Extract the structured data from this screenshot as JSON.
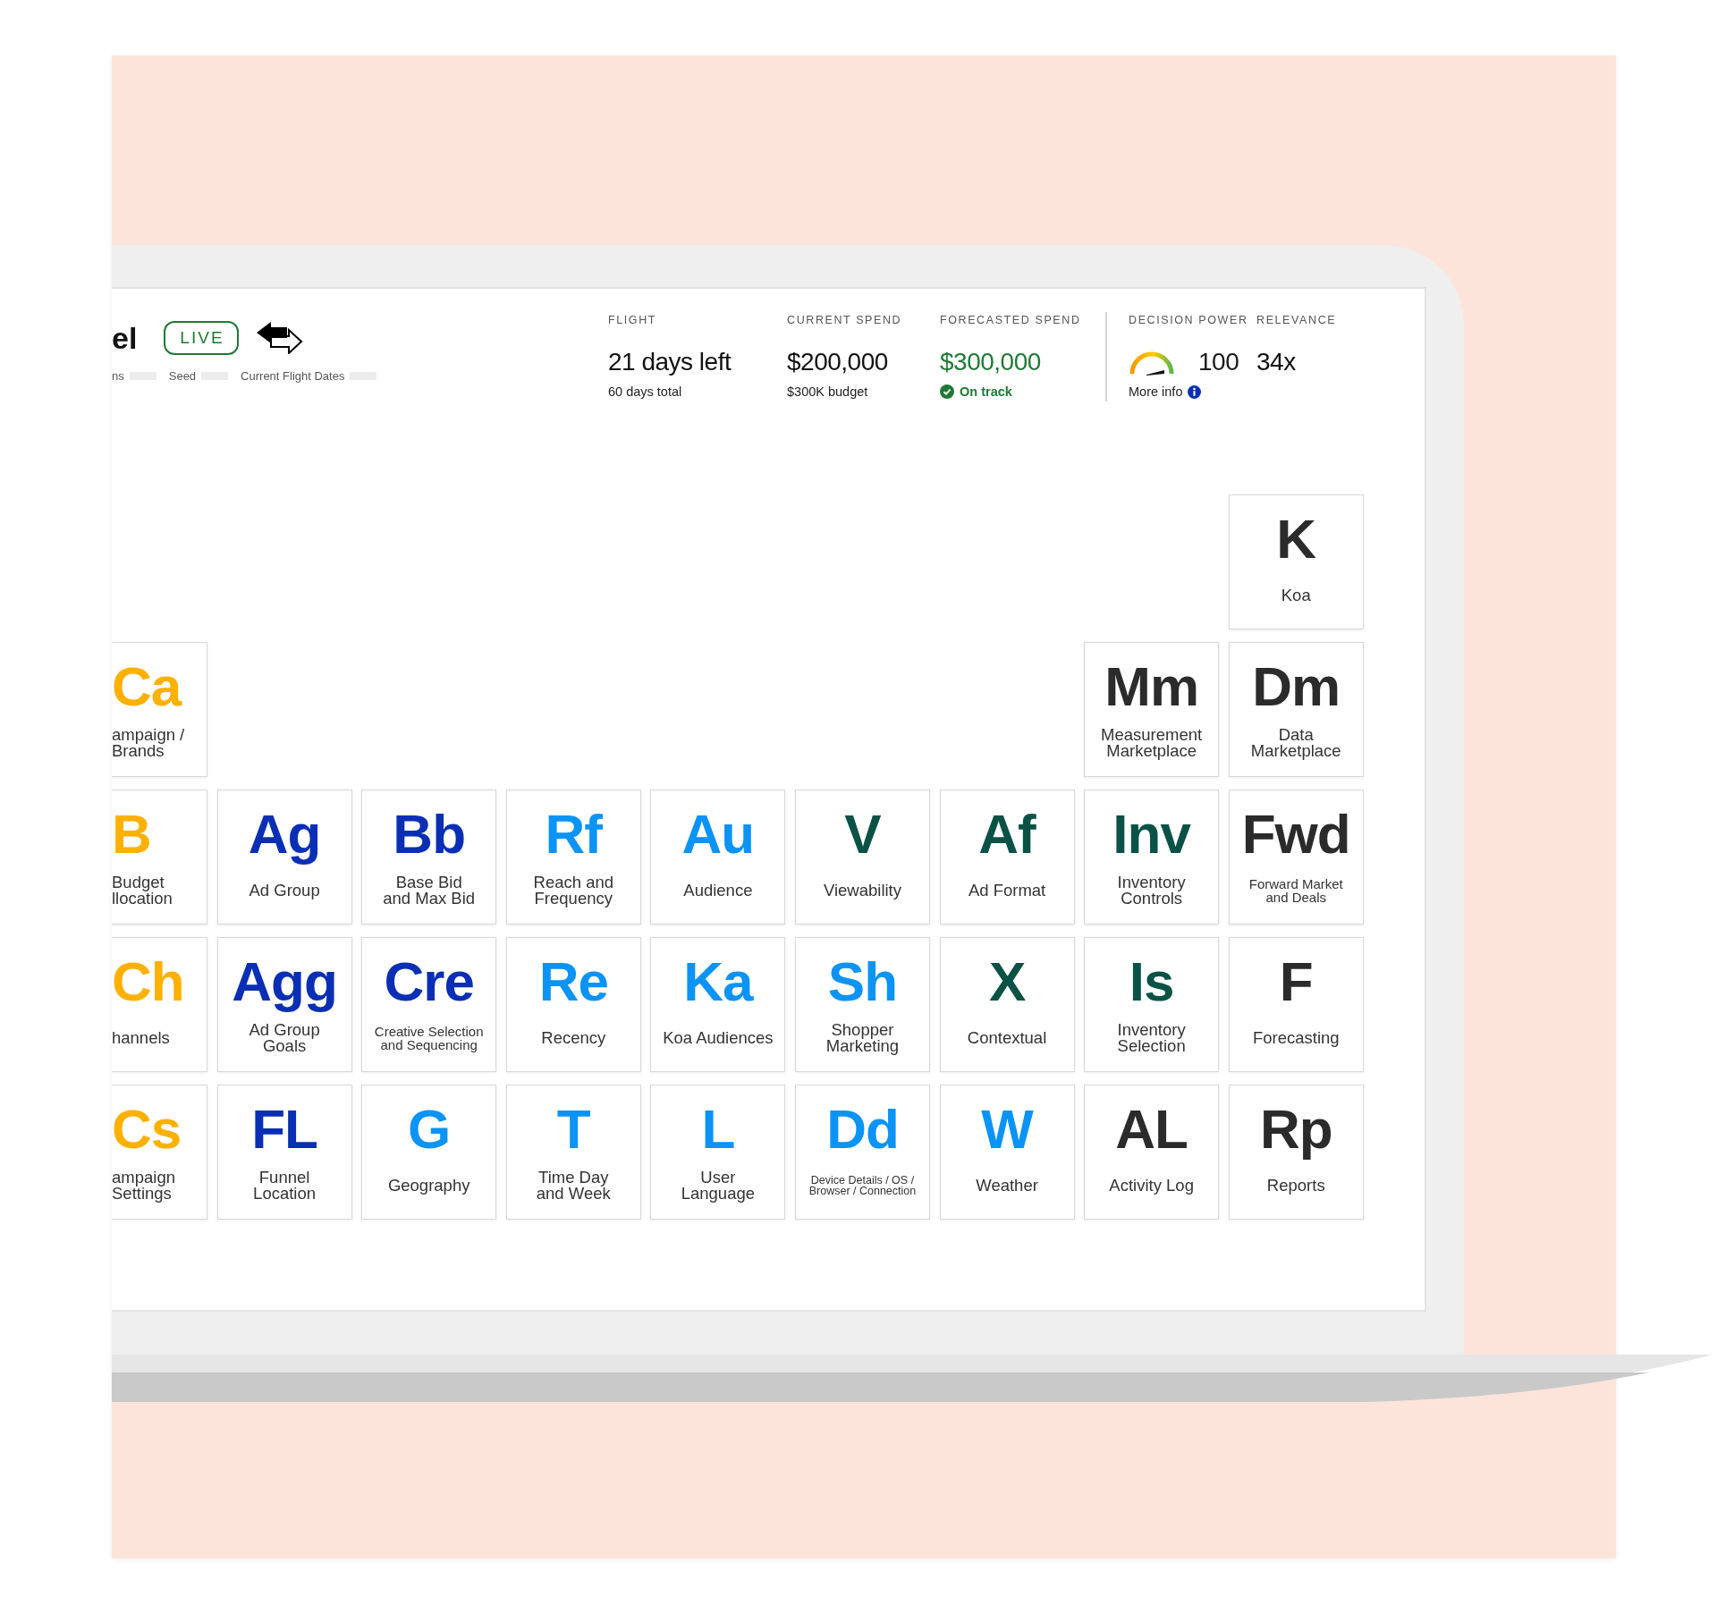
{
  "header": {
    "title": "el",
    "status_badge": "LIVE",
    "filters": [
      "ns",
      "Seed",
      "Current Flight Dates"
    ]
  },
  "metrics": [
    {
      "kind": "text",
      "label": "FLIGHT",
      "value": "21 days left",
      "note": "60 days total"
    },
    {
      "kind": "text",
      "label": "CURRENT SPEND",
      "value": "$200,000",
      "note": "$300K budget"
    },
    {
      "kind": "status",
      "label": "FORECASTED SPEND",
      "value": "$300,000",
      "note": "On track"
    }
  ],
  "scores": [
    {
      "kind": "gauge",
      "label": "DECISION POWER",
      "value": "100",
      "note": "More info"
    },
    {
      "kind": "text",
      "label": "RELEVANCE",
      "value": "34x"
    }
  ],
  "tile_rows": [
    {
      "end": [
        {
          "symbol": "K",
          "label": "Koa",
          "color": "#2b2b2b"
        }
      ]
    },
    {
      "start": [
        {
          "symbol": "Ca",
          "label": "ampaign /\nBrands",
          "color": "#ffb000"
        }
      ],
      "end": [
        {
          "symbol": "Mm",
          "label": "Measurement\nMarketplace",
          "color": "#2b2b2b"
        },
        {
          "symbol": "Dm",
          "label": "Data\nMarketplace",
          "color": "#2b2b2b"
        }
      ]
    },
    {
      "start": [
        {
          "symbol": "B",
          "label": "Budget\nllocation",
          "color": "#ffb000"
        },
        {
          "symbol": "Ag",
          "label": "Ad Group",
          "color": "#0a2fb5"
        },
        {
          "symbol": "Bb",
          "label": "Base Bid\nand Max Bid",
          "color": "#0a2fb5"
        },
        {
          "symbol": "Rf",
          "label": "Reach and\nFrequency",
          "color": "#0b93f6"
        },
        {
          "symbol": "Au",
          "label": "Audience",
          "color": "#0b93f6"
        },
        {
          "symbol": "V",
          "label": "Viewability",
          "color": "#0a5246"
        },
        {
          "symbol": "Af",
          "label": "Ad Format",
          "color": "#0a5246"
        },
        {
          "symbol": "Inv",
          "label": "Inventory\nControls",
          "color": "#0a5246"
        },
        {
          "symbol": "Fwd",
          "label": "Forward Market\nand Deals",
          "color": "#2b2b2b"
        }
      ]
    },
    {
      "start": [
        {
          "symbol": "Ch",
          "label": "hannels",
          "color": "#ffb000"
        },
        {
          "symbol": "Agg",
          "label": "Ad Group\nGoals",
          "color": "#0a2fb5"
        },
        {
          "symbol": "Cre",
          "label": "Creative Selection\nand Sequencing",
          "color": "#0a2fb5"
        },
        {
          "symbol": "Re",
          "label": "Recency",
          "color": "#0b93f6"
        },
        {
          "symbol": "Ka",
          "label": "Koa Audiences",
          "color": "#0b93f6"
        },
        {
          "symbol": "Sh",
          "label": "Shopper\nMarketing",
          "color": "#0b93f6"
        },
        {
          "symbol": "X",
          "label": "Contextual",
          "color": "#0a5246"
        },
        {
          "symbol": "Is",
          "label": "Inventory\nSelection",
          "color": "#0a5246"
        },
        {
          "symbol": "F",
          "label": "Forecasting",
          "color": "#2b2b2b"
        }
      ]
    },
    {
      "start": [
        {
          "symbol": "Cs",
          "label": "ampaign\nSettings",
          "color": "#ffb000"
        },
        {
          "symbol": "FL",
          "label": "Funnel\nLocation",
          "color": "#0a2fb5"
        },
        {
          "symbol": "G",
          "label": "Geography",
          "color": "#0b93f6"
        },
        {
          "symbol": "T",
          "label": "Time Day\nand Week",
          "color": "#0b93f6"
        },
        {
          "symbol": "L",
          "label": "User\nLanguage",
          "color": "#0b93f6"
        },
        {
          "symbol": "Dd",
          "label": "Device Details / OS /\nBrowser / Connection",
          "color": "#0b93f6"
        },
        {
          "symbol": "W",
          "label": "Weather",
          "color": "#0b93f6"
        },
        {
          "symbol": "AL",
          "label": "Activity Log",
          "color": "#2b2b2b"
        },
        {
          "symbol": "Rp",
          "label": "Reports",
          "color": "#2b2b2b"
        }
      ]
    }
  ]
}
